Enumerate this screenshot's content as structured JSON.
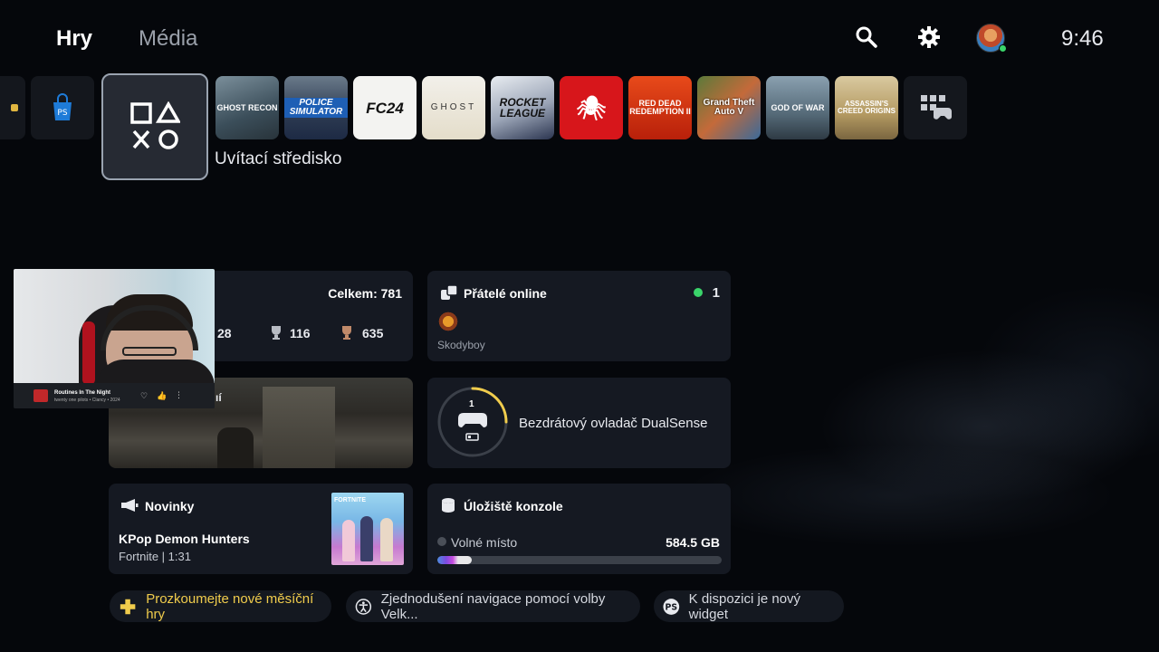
{
  "nav": {
    "tabs": [
      {
        "label": "Hry",
        "active": true
      },
      {
        "label": "Média",
        "active": false
      }
    ],
    "clock": "9:46",
    "icons": [
      "search-icon",
      "settings-icon",
      "avatar"
    ]
  },
  "games_row": {
    "focused_label": "Uvítací středisko",
    "tiles": [
      {
        "name": "Ghost Recon Breakpoint",
        "text": "GHOST RECON"
      },
      {
        "name": "Police Simulator",
        "text": "POLICE SIMULATOR"
      },
      {
        "name": "FC 24",
        "text": "FC24"
      },
      {
        "name": "Ghost of Tsushima",
        "text": "GHOST"
      },
      {
        "name": "Rocket League",
        "text": "ROCKET LEAGUE"
      },
      {
        "name": "Marvel's Spider-Man",
        "text": "🕷"
      },
      {
        "name": "Red Dead Redemption II",
        "text": "RED DEAD REDEMPTION II"
      },
      {
        "name": "Grand Theft Auto V",
        "text": "Grand Theft Auto V"
      },
      {
        "name": "God of War",
        "text": "GOD OF WAR"
      },
      {
        "name": "Assassin's Creed Origins",
        "text": "ASSASSIN'S CREED ORIGINS"
      }
    ]
  },
  "trophies": {
    "total_label": "Celkem: 781",
    "platinum": "28",
    "gold": "116",
    "silver": "635"
  },
  "pip": {
    "song": "Routines In The Night",
    "artist": "twenty one pilots • Clancy • 2024"
  },
  "friends": {
    "title": "Přátelé online",
    "count": "1",
    "friend_name": "Skodyboy"
  },
  "controller": {
    "label": "Bezdrátový ovladač DualSense",
    "number": "1",
    "battery_level": 0.25
  },
  "news": {
    "title": "Novinky",
    "headline": "KPop Demon Hunters",
    "meta": "Fortnite | 1:31",
    "thumb_text": "FORTNITE"
  },
  "storage": {
    "title": "Úložiště konzole",
    "free_label": "Volné místo",
    "free_value": "584.5 GB",
    "used_fraction": 0.12
  },
  "footer": {
    "pill1": "Prozkoumejte nové měsíční hry",
    "pill2": "Zjednodušení navigace pomocí volby Velk...",
    "pill3": "K dispozici je nový widget"
  },
  "colors": {
    "accent_gold": "#f0cc4c",
    "online_green": "#3ad46a",
    "background": "#05070b",
    "card": "#151922"
  }
}
